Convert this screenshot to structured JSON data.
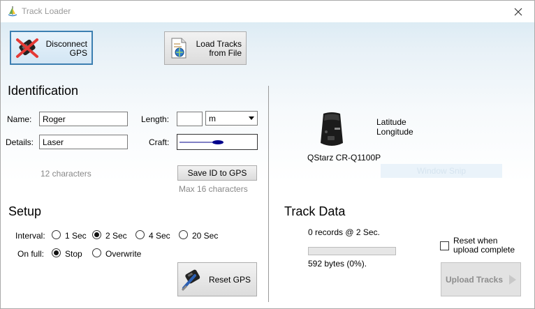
{
  "window": {
    "title": "Track Loader"
  },
  "toolbar": {
    "disconnect_label_1": "Disconnect",
    "disconnect_label_2": "GPS",
    "load_label_1": "Load Tracks",
    "load_label_2": "from File"
  },
  "identification": {
    "heading": "Identification",
    "name_label": "Name:",
    "name_value": "Roger",
    "details_label": "Details:",
    "details_value": "Laser",
    "length_label": "Length:",
    "length_value": "",
    "length_unit": "m",
    "craft_label": "Craft:",
    "char_count": "12 characters",
    "save_button": "Save ID to GPS",
    "max_chars": "Max 16 characters"
  },
  "setup": {
    "heading": "Setup",
    "interval_label": "Interval:",
    "interval_options": [
      "1 Sec",
      "2 Sec",
      "4 Sec",
      "20 Sec"
    ],
    "interval_selected": "2 Sec",
    "onfull_label": "On full:",
    "onfull_options": [
      "Stop",
      "Overwrite"
    ],
    "onfull_selected": "Stop",
    "reset_button": "Reset GPS"
  },
  "device": {
    "model": "QStarz CR-Q1100P",
    "latitude_label": "Latitude",
    "longitude_label": "Longitude",
    "window_snip": "Window Snip"
  },
  "track_data": {
    "heading": "Track Data",
    "records": "0 records @ 2 Sec.",
    "progress_fraction": 0.0,
    "bytes": "592 bytes (0%).",
    "reset_checkbox_label_1": "Reset when",
    "reset_checkbox_label_2": "upload complete",
    "reset_checked": false,
    "upload_button": "Upload Tracks"
  },
  "colors": {
    "accent_border": "#3c7fb1",
    "craft_line": "#00008b",
    "progress_track": "#e6e6e6"
  },
  "icons": [
    "track-loader-app-icon",
    "close-icon",
    "gps-disconnect-icon",
    "load-file-icon",
    "gps-device-icon",
    "reset-gps-icon",
    "dropdown-arrow-icon",
    "upload-arrow-icon"
  ]
}
